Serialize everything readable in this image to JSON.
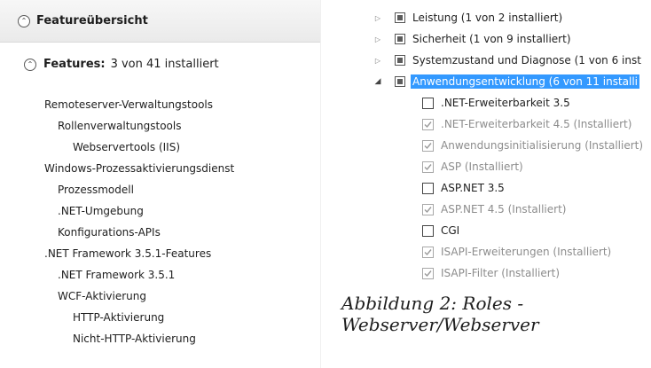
{
  "left": {
    "section_title": "Featureübersicht",
    "features_label": "Features:",
    "features_count": "3 von 41 installiert",
    "items": [
      "Remoteserver-Verwaltungstools",
      "Rollenverwaltungstools",
      "Webservertools (IIS)",
      "Windows-Prozessaktivierungsdienst",
      "Prozessmodell",
      ".NET-Umgebung",
      "Konfigurations-APIs",
      ".NET Framework 3.5.1-Features",
      ".NET Framework 3.5.1",
      "WCF-Aktivierung",
      "HTTP-Aktivierung",
      "Nicht-HTTP-Aktivierung"
    ]
  },
  "tree": {
    "groups": [
      {
        "label": "Leistung (1 von 2 installiert)",
        "state": "collapsed"
      },
      {
        "label": "Sicherheit (1 von 9 installiert)",
        "state": "collapsed"
      },
      {
        "label": "Systemzustand und Diagnose (1 von 6 inst",
        "state": "collapsed"
      },
      {
        "label": "Anwendungsentwicklung (6 von 11 installi",
        "state": "expanded",
        "selected": true
      }
    ],
    "children": [
      {
        "label": ".NET-Erweiterbarkeit 3.5",
        "checked": false,
        "installed": false
      },
      {
        "label": ".NET-Erweiterbarkeit 4.5 (Installiert)",
        "checked": true,
        "installed": true
      },
      {
        "label": "Anwendungsinitialisierung (Installiert)",
        "checked": true,
        "installed": true
      },
      {
        "label": "ASP (Installiert)",
        "checked": true,
        "installed": true
      },
      {
        "label": "ASP.NET 3.5",
        "checked": false,
        "installed": false
      },
      {
        "label": "ASP.NET 4.5 (Installiert)",
        "checked": true,
        "installed": true
      },
      {
        "label": "CGI",
        "checked": false,
        "installed": false
      },
      {
        "label": "ISAPI-Erweiterungen (Installiert)",
        "checked": true,
        "installed": true
      },
      {
        "label": "ISAPI-Filter (Installiert)",
        "checked": true,
        "installed": true
      }
    ]
  },
  "caption": {
    "line1": "Abbildung 2: Roles -",
    "line2": "Webserver/Webserver"
  }
}
